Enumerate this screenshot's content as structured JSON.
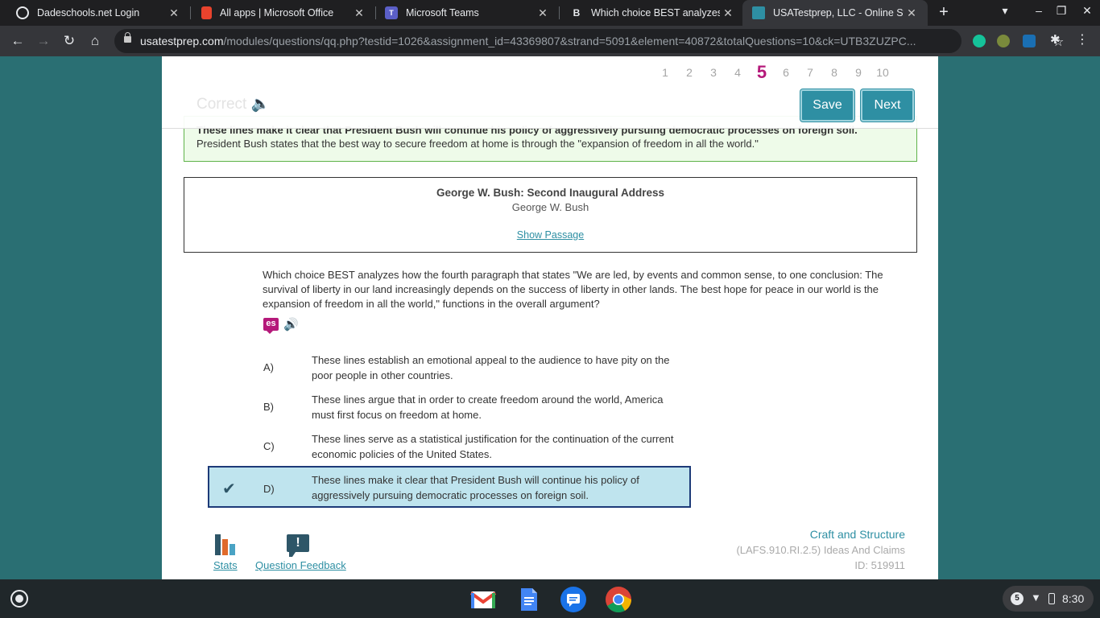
{
  "browser": {
    "tabs": [
      {
        "title": "Dadeschools.net Login",
        "favicon": "globe-icon",
        "color": "#e8eaed"
      },
      {
        "title": "All apps | Microsoft Office",
        "favicon": "office-icon",
        "color": "#e8432d"
      },
      {
        "title": "Microsoft Teams",
        "favicon": "teams-icon",
        "color": "#5b5fc7"
      },
      {
        "title": "Which choice BEST analyzes h",
        "favicon": "brainly-icon",
        "color": "#e8eaed"
      },
      {
        "title": "USATestprep, LLC - Online Stat",
        "favicon": "usatestprep-icon",
        "color": "#2e8fa3"
      }
    ],
    "active_tab_index": 4,
    "new_tab": "+",
    "url_domain": "usatestprep.com",
    "url_path": "/modules/questions/qq.php?testid=1026&assignment_id=43369807&strand=5091&element=40872&totalQuestions=10&ck=UTB3ZUZPC..."
  },
  "question_nav": {
    "numbers": [
      "1",
      "2",
      "3",
      "4",
      "5",
      "6",
      "7",
      "8",
      "9",
      "10"
    ],
    "current": "5",
    "status_label": "Correct",
    "save_label": "Save",
    "next_label": "Next"
  },
  "feedback": {
    "bold": "These lines make it clear that President Bush will continue his policy of aggressively pursuing democratic processes on foreign soil.",
    "text": "President Bush states that the best way to secure freedom at home is through the \"expansion of freedom in all the world.\""
  },
  "passage": {
    "title": "George W. Bush: Second Inaugural Address",
    "author": "George W. Bush",
    "show_link": "Show Passage"
  },
  "question": {
    "text": "Which choice BEST analyzes how the fourth paragraph that states \"We are led, by events and common sense, to one conclusion: The survival of liberty in our land increasingly depends on the success of liberty in other lands. The best hope for peace in our world is the expansion of freedom in all the world,\" functions in the overall argument?",
    "translate_icon_text": "es"
  },
  "choices": [
    {
      "letter": "A)",
      "text": "These lines establish an emotional appeal to the audience to have pity on the poor people in other countries."
    },
    {
      "letter": "B)",
      "text": "These lines argue that in order to create freedom around the world, America must first focus on freedom at home."
    },
    {
      "letter": "C)",
      "text": "These lines serve as a statistical justification for the continuation of the current economic policies of the United States."
    },
    {
      "letter": "D)",
      "text": "These lines make it clear that President Bush will continue his policy of aggressively pursuing democratic processes on foreign soil."
    }
  ],
  "selected_choice": "D)",
  "footer": {
    "stats_label": "Stats",
    "feedback_label": "Question Feedback",
    "feedback_icon_text": "!",
    "category": "Craft and Structure",
    "standard": "(LAFS.910.RI.2.5) Ideas And Claims",
    "id": "ID: 519911"
  },
  "shelf": {
    "apps": [
      "gmail-icon",
      "docs-icon",
      "messages-icon",
      "chrome-icon"
    ],
    "notification_count": "5",
    "time": "8:30"
  },
  "colors": {
    "accent": "#2e8fa3",
    "current_question": "#b5197a",
    "selected_bg": "#bfe4ee",
    "selected_border": "#1d3a78",
    "feedback_border": "#5fb34a"
  }
}
